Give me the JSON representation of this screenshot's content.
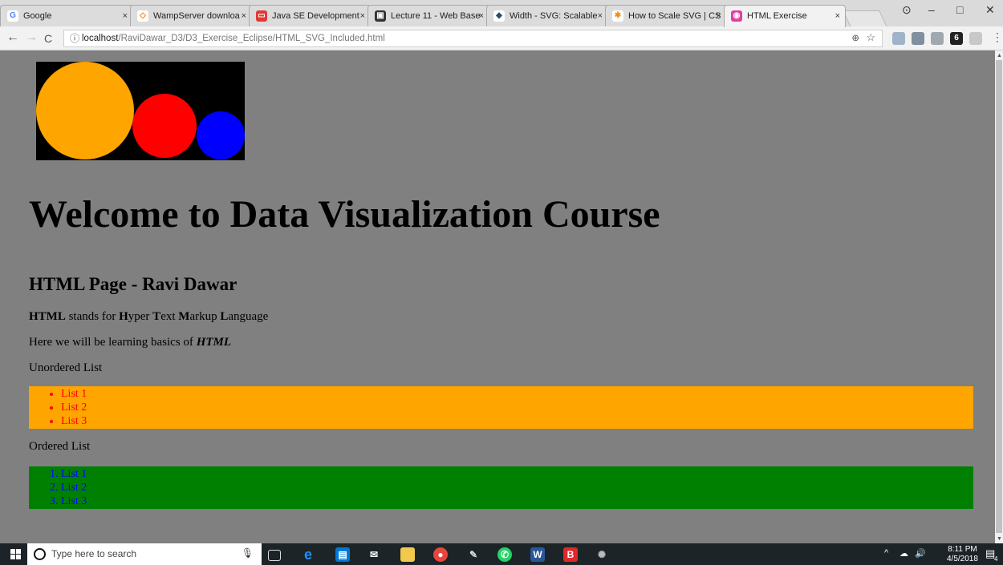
{
  "browser": {
    "tabs": [
      {
        "title": "Google",
        "favicon": "google-icon",
        "color": "#4285f4",
        "glyph": "G"
      },
      {
        "title": "WampServer downloa",
        "favicon": "wamp-icon",
        "color": "#ff7f00",
        "glyph": "◇"
      },
      {
        "title": "Java SE Development",
        "favicon": "oracle-icon",
        "color": "#e53935",
        "glyph": "▭"
      },
      {
        "title": "Lecture 11 - Web Base",
        "favicon": "lecture-icon",
        "color": "#333333",
        "glyph": "▣"
      },
      {
        "title": "Width - SVG: Scalable",
        "favicon": "mdn-icon",
        "color": "#1f4e79",
        "glyph": "◆"
      },
      {
        "title": "How to Scale SVG | CS",
        "favicon": "css-tricks-icon",
        "color": "#ff8a00",
        "glyph": "✱"
      },
      {
        "title": "HTML Exercise",
        "favicon": "html-exercise-icon",
        "color": "#e040a0",
        "glyph": "◉"
      }
    ],
    "tab_close": "×",
    "window_controls": {
      "profile": "⊙",
      "minimize": "–",
      "maximize": "□",
      "close": "✕"
    },
    "nav": {
      "back": "←",
      "forward": "→",
      "reload": "C"
    },
    "address": {
      "info_glyph": "ⓘ",
      "host": "localhost",
      "path": "/RaviDawar_D3/D3_Exercise_Eclipse/HTML_SVG_Included.html",
      "zoom": "⊕",
      "star": "☆"
    },
    "menu": "⋮"
  },
  "page": {
    "svg": {
      "background": "#000000",
      "circle_colors": [
        "#ffa500",
        "#ff0000",
        "#0000ff"
      ]
    },
    "heading": "Welcome to Data Visualization Course",
    "subheading": "HTML Page - Ravi Dawar",
    "definition": {
      "html": "HTML",
      "stands": " stands for ",
      "h": "H",
      "yper": "yper ",
      "t": "T",
      "ext": "ext ",
      "m": "M",
      "arkup": "arkup ",
      "l": "L",
      "anguage": "anguage"
    },
    "learning": {
      "text": "Here we will be learning basics of ",
      "em": "HTML"
    },
    "unordered_label": "Unordered List",
    "unordered_items": [
      "List 1",
      "List 2",
      "List 3"
    ],
    "ordered_label": "Ordered List",
    "ordered_items": [
      "List 1",
      "List 2",
      "List 3"
    ],
    "colors": {
      "ul_bg": "#ffa500",
      "ul_text": "#ff0000",
      "ol_bg": "#008000",
      "ol_text": "#0000ff",
      "page_bg": "#808080"
    }
  },
  "taskbar": {
    "search_placeholder": "Type here to search",
    "apps": [
      "task-view-icon",
      "edge-icon",
      "store-icon",
      "mail-icon",
      "file-explorer-icon",
      "chrome-icon",
      "paint-icon",
      "whatsapp-icon",
      "word-icon",
      "b-app-icon",
      "settings-icon"
    ],
    "time": "8:11 PM",
    "date": "4/5/2018",
    "notifications": "4"
  }
}
